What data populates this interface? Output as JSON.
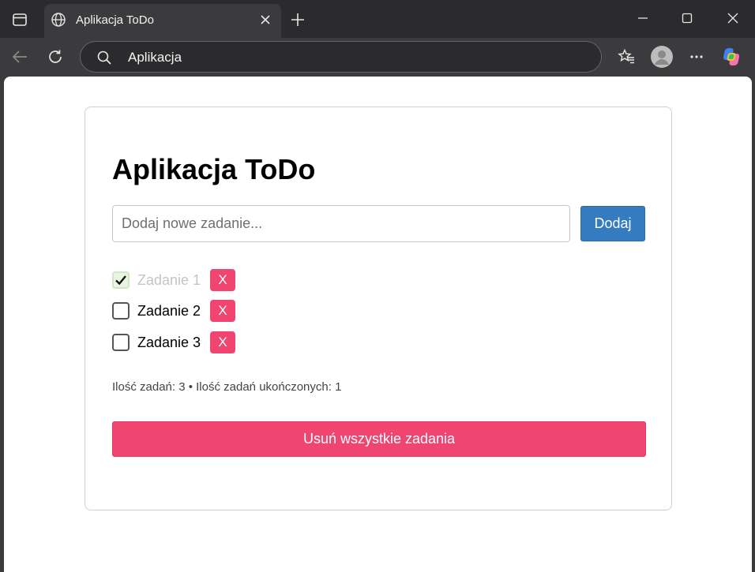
{
  "browser": {
    "tab_title": "Aplikacja ToDo",
    "address": "Aplikacja"
  },
  "app": {
    "title": "Aplikacja ToDo",
    "input_placeholder": "Dodaj nowe zadanie...",
    "input_value": "",
    "add_label": "Dodaj",
    "tasks": [
      {
        "label": "Zadanie 1",
        "done": true,
        "delete_label": "X"
      },
      {
        "label": "Zadanie 2",
        "done": false,
        "delete_label": "X"
      },
      {
        "label": "Zadanie 3",
        "done": false,
        "delete_label": "X"
      }
    ],
    "stats": "Ilość zadań: 3 • Ilość zadań ukończonych: 1",
    "clear_label": "Usuń wszystkie zadania"
  },
  "colors": {
    "primary_blue": "#347bc0",
    "danger_pink": "#ef4570",
    "done_text": "#c4c4c4"
  },
  "icons": [
    "sidebar-icon",
    "globe-icon",
    "close-icon",
    "plus-icon",
    "minimize-icon",
    "maximize-icon",
    "back-icon",
    "refresh-icon",
    "search-icon",
    "favorites-icon",
    "profile-icon",
    "more-icon",
    "copilot-icon",
    "check-icon"
  ]
}
